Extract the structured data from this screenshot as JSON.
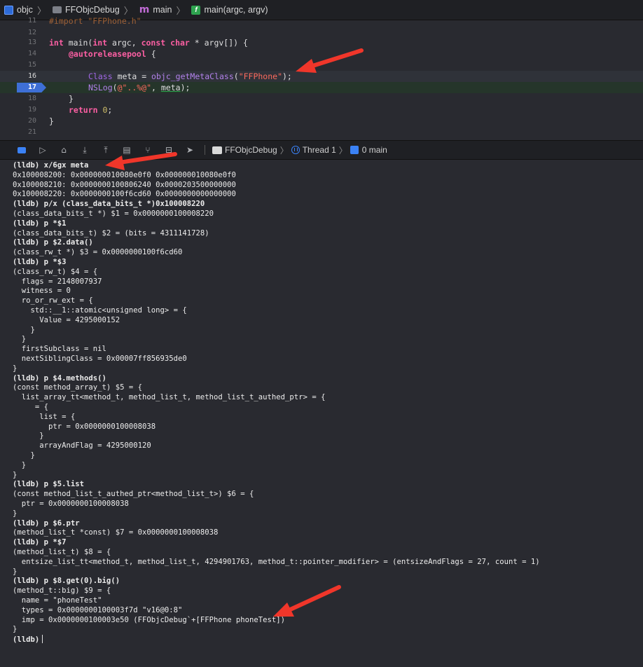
{
  "jumpbar": {
    "project": "objc",
    "folder": "FFObjcDebug",
    "file_symbol": "m",
    "file": "main",
    "function_symbol": "f",
    "function": "main(argc, argv)"
  },
  "editor": {
    "top_partial": "#import \"FFPhone.h\"",
    "line_numbers": [
      "12",
      "13",
      "14",
      "15",
      "16",
      "17",
      "18",
      "19",
      "20",
      "21"
    ],
    "breakpoint_line": "17",
    "meta_decl": {
      "type": "Class",
      "var": "meta",
      "eq": " = ",
      "func": "objc_getMetaClass",
      "open": "(",
      "arg": "\"FFPhone\"",
      "close": ");"
    },
    "nslog": {
      "func": "NSLog",
      "open": "(",
      "fmt": "@\"..%@\"",
      "sep": ", ",
      "arg": "meta",
      "close": ");"
    },
    "main_sig": {
      "kw1": "int",
      "name": " main(",
      "kw2": "int",
      "p1": " argc, ",
      "kw3": "const",
      "sp": " ",
      "kw4": "char",
      "rest": " * argv[]) {"
    },
    "autorelease": "@autoreleasepool",
    "brace_open": " {",
    "return_kw": "return",
    "return_val": "0",
    "semi": ";",
    "close_inner": "}",
    "close_outer": "}"
  },
  "debugbar": {
    "process": "FFObjcDebug",
    "thread": "Thread 1",
    "frame": "0 main"
  },
  "console": {
    "lines": [
      "(lldb) x/6gx meta",
      "0x100008200: 0x000000010080e0f0 0x000000010080e0f0",
      "0x100008210: 0x0000000100806240 0x0000203500000000",
      "0x100008220: 0x0000000100f6cd60 0x0000000000000000",
      "(lldb) p/x (class_data_bits_t *)0x100008220",
      "(class_data_bits_t *) $1 = 0x0000000100008220",
      "(lldb) p *$1",
      "(class_data_bits_t) $2 = (bits = 4311141728)",
      "(lldb) p $2.data()",
      "(class_rw_t *) $3 = 0x0000000100f6cd60",
      "(lldb) p *$3",
      "(class_rw_t) $4 = {",
      "  flags = 2148007937",
      "  witness = 0",
      "  ro_or_rw_ext = {",
      "    std::__1::atomic<unsigned long> = {",
      "      Value = 4295000152",
      "    }",
      "  }",
      "  firstSubclass = nil",
      "  nextSiblingClass = 0x00007ff856935de0",
      "}",
      "(lldb) p $4.methods()",
      "(const method_array_t) $5 = {",
      "  list_array_tt<method_t, method_list_t, method_list_t_authed_ptr> = {",
      "     = {",
      "      list = {",
      "        ptr = 0x0000000100008038",
      "      }",
      "      arrayAndFlag = 4295000120",
      "    }",
      "  }",
      "}",
      "(lldb) p $5.list",
      "(const method_list_t_authed_ptr<method_list_t>) $6 = {",
      "  ptr = 0x0000000100008038",
      "}",
      "(lldb) p $6.ptr",
      "(method_list_t *const) $7 = 0x0000000100008038",
      "(lldb) p *$7",
      "(method_list_t) $8 = {",
      "  entsize_list_tt<method_t, method_list_t, 4294901763, method_t::pointer_modifier> = (entsizeAndFlags = 27, count = 1)",
      "}",
      "(lldb) p $8.get(0).big()",
      "(method_t::big) $9 = {",
      "  name = \"phoneTest\"",
      "  types = 0x0000000100003f7d \"v16@0:8\"",
      "  imp = 0x0000000100003e50 (FFObjcDebug`+[FFPhone phoneTest])",
      "}",
      "(lldb)"
    ]
  },
  "colors": {
    "background": "#292a30",
    "keyword": "#fc5fa3",
    "string": "#fc6a5d",
    "breakpoint": "#3e6fd6",
    "annotation_arrow": "#f0362a"
  }
}
